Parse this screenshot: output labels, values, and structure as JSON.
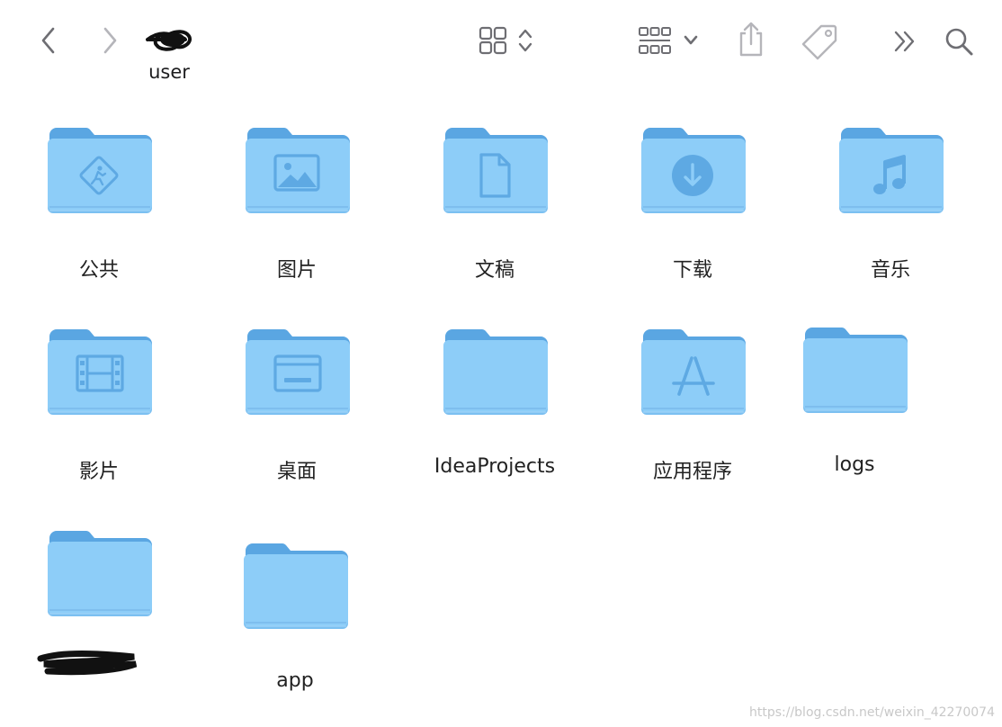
{
  "window": {
    "title": "user",
    "nav": {
      "back_label": "Back",
      "forward_label": "Forward"
    },
    "toolbar": {
      "view_icon": "grid-view-icon",
      "view_sort_icon": "chevron-up-down-icon",
      "group_icon": "group-view-icon",
      "group_menu_icon": "chevron-down-icon",
      "share_icon": "share-icon",
      "tag_icon": "tag-icon",
      "more_icon": "double-chevron-right-icon",
      "search_icon": "search-icon"
    }
  },
  "items": [
    {
      "label": "公共",
      "icon": "public-icon"
    },
    {
      "label": "图片",
      "icon": "pictures-icon"
    },
    {
      "label": "文稿",
      "icon": "document-icon"
    },
    {
      "label": "下载",
      "icon": "download-icon"
    },
    {
      "label": "音乐",
      "icon": "music-icon"
    },
    {
      "label": "影片",
      "icon": "movies-icon"
    },
    {
      "label": "桌面",
      "icon": "desktop-icon"
    },
    {
      "label": "IdeaProjects",
      "icon": ""
    },
    {
      "label": "应用程序",
      "icon": "apps-icon"
    },
    {
      "label": "logs",
      "icon": ""
    },
    {
      "label": "",
      "icon": ""
    },
    {
      "label": "app",
      "icon": ""
    }
  ],
  "colors": {
    "folder_back": "#5aa6e2",
    "folder_front": "#8dcdf8",
    "folder_glyph": "#5ea9e3",
    "toolbar_icon": "#6e6e73",
    "toolbar_icon_disabled": "#b5b5ba"
  },
  "watermark": "https://blog.csdn.net/weixin_42270074"
}
